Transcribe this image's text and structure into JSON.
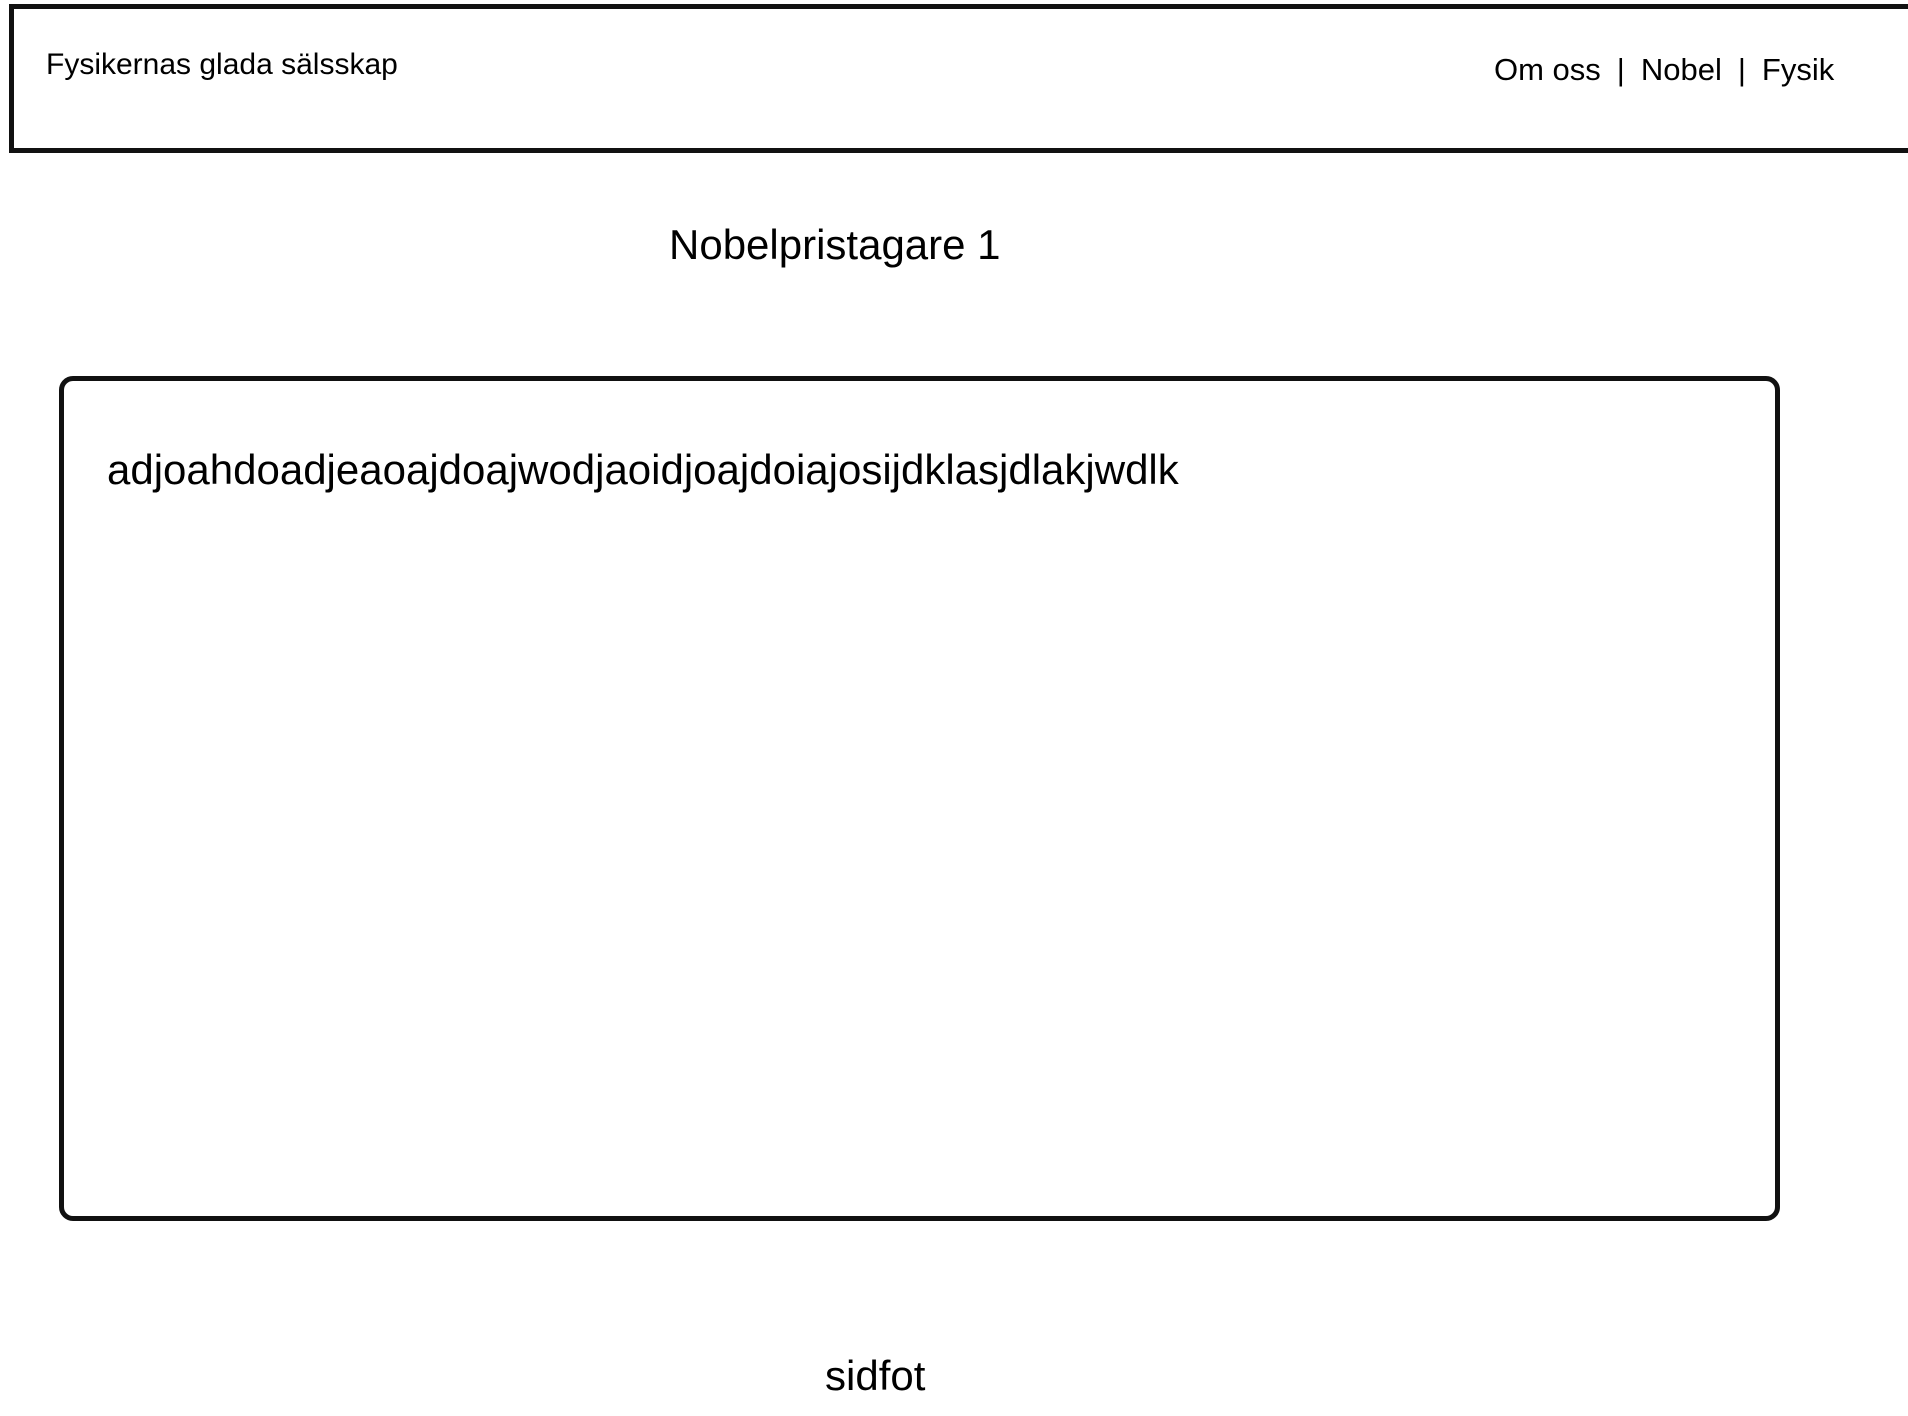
{
  "header": {
    "site_title": "Fysikernas glada sälsskap",
    "nav": {
      "items": [
        "Om oss",
        "Nobel",
        "Fysik"
      ],
      "separator": "|"
    }
  },
  "main": {
    "page_title": "Nobelpristagare 1",
    "content_text": "adjoahdoadjeaoajdoajwodjaoidjoajdoiajosijdklasjdlakjwdlk"
  },
  "footer": {
    "text": "sidfot"
  }
}
